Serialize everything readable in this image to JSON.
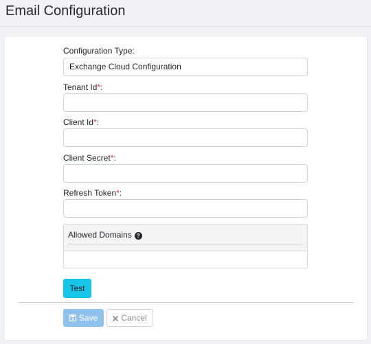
{
  "page": {
    "title": "Email Configuration"
  },
  "form": {
    "configuration_type": {
      "label": "Configuration Type:",
      "value": "Exchange Cloud Configuration"
    },
    "tenant_id": {
      "label": "Tenant Id",
      "required_mark": "*",
      "suffix": ":",
      "value": ""
    },
    "client_id": {
      "label": "Client Id",
      "required_mark": "*",
      "suffix": ":",
      "value": ""
    },
    "client_secret": {
      "label": "Client Secret",
      "required_mark": "*",
      "suffix": ":",
      "value": ""
    },
    "refresh_token": {
      "label": "Refresh Token",
      "required_mark": "*",
      "suffix": ":",
      "value": ""
    },
    "allowed_domains": {
      "title": "Allowed Domains",
      "help_icon_glyph": "?"
    }
  },
  "buttons": {
    "test_label": "Test",
    "save_label": "Save",
    "cancel_label": "Cancel",
    "save_icon": "floppy-disk-icon",
    "cancel_icon": "times-icon"
  },
  "colors": {
    "test_button": "#17c5e8",
    "save_button_disabled": "#8fc1ec",
    "required_mark": "#dc3545"
  }
}
